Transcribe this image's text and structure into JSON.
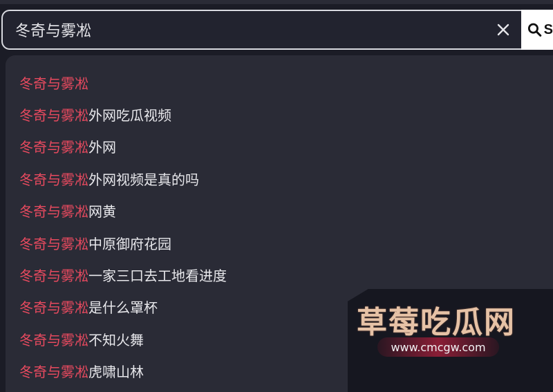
{
  "search": {
    "value": "冬奇与雾凇"
  },
  "search_button": {
    "label": "S"
  },
  "suggestions": [
    {
      "highlight": "冬奇与雾凇",
      "rest": ""
    },
    {
      "highlight": "冬奇与雾凇",
      "rest": "外网吃瓜视频"
    },
    {
      "highlight": "冬奇与雾凇",
      "rest": "外网"
    },
    {
      "highlight": "冬奇与雾凇",
      "rest": "外网视频是真的吗"
    },
    {
      "highlight": "冬奇与雾凇",
      "rest": "网黄"
    },
    {
      "highlight": "冬奇与雾凇",
      "rest": "中原御府花园"
    },
    {
      "highlight": "冬奇与雾凇",
      "rest": "一家三口去工地看进度"
    },
    {
      "highlight": "冬奇与雾凇",
      "rest": "是什么罩杯"
    },
    {
      "highlight": "冬奇与雾凇",
      "rest": "不知火舞"
    },
    {
      "highlight": "冬奇与雾凇",
      "rest": "虎啸山林"
    }
  ],
  "watermark": {
    "title": "草莓吃瓜网",
    "url": "www.cmcgw.com"
  },
  "icons": {
    "clear": "close-icon",
    "search": "search-icon"
  },
  "colors": {
    "background": "#1b1c26",
    "dropdown": "#2a2b36",
    "highlight": "#e84a5f",
    "text": "#e8e8ec"
  }
}
